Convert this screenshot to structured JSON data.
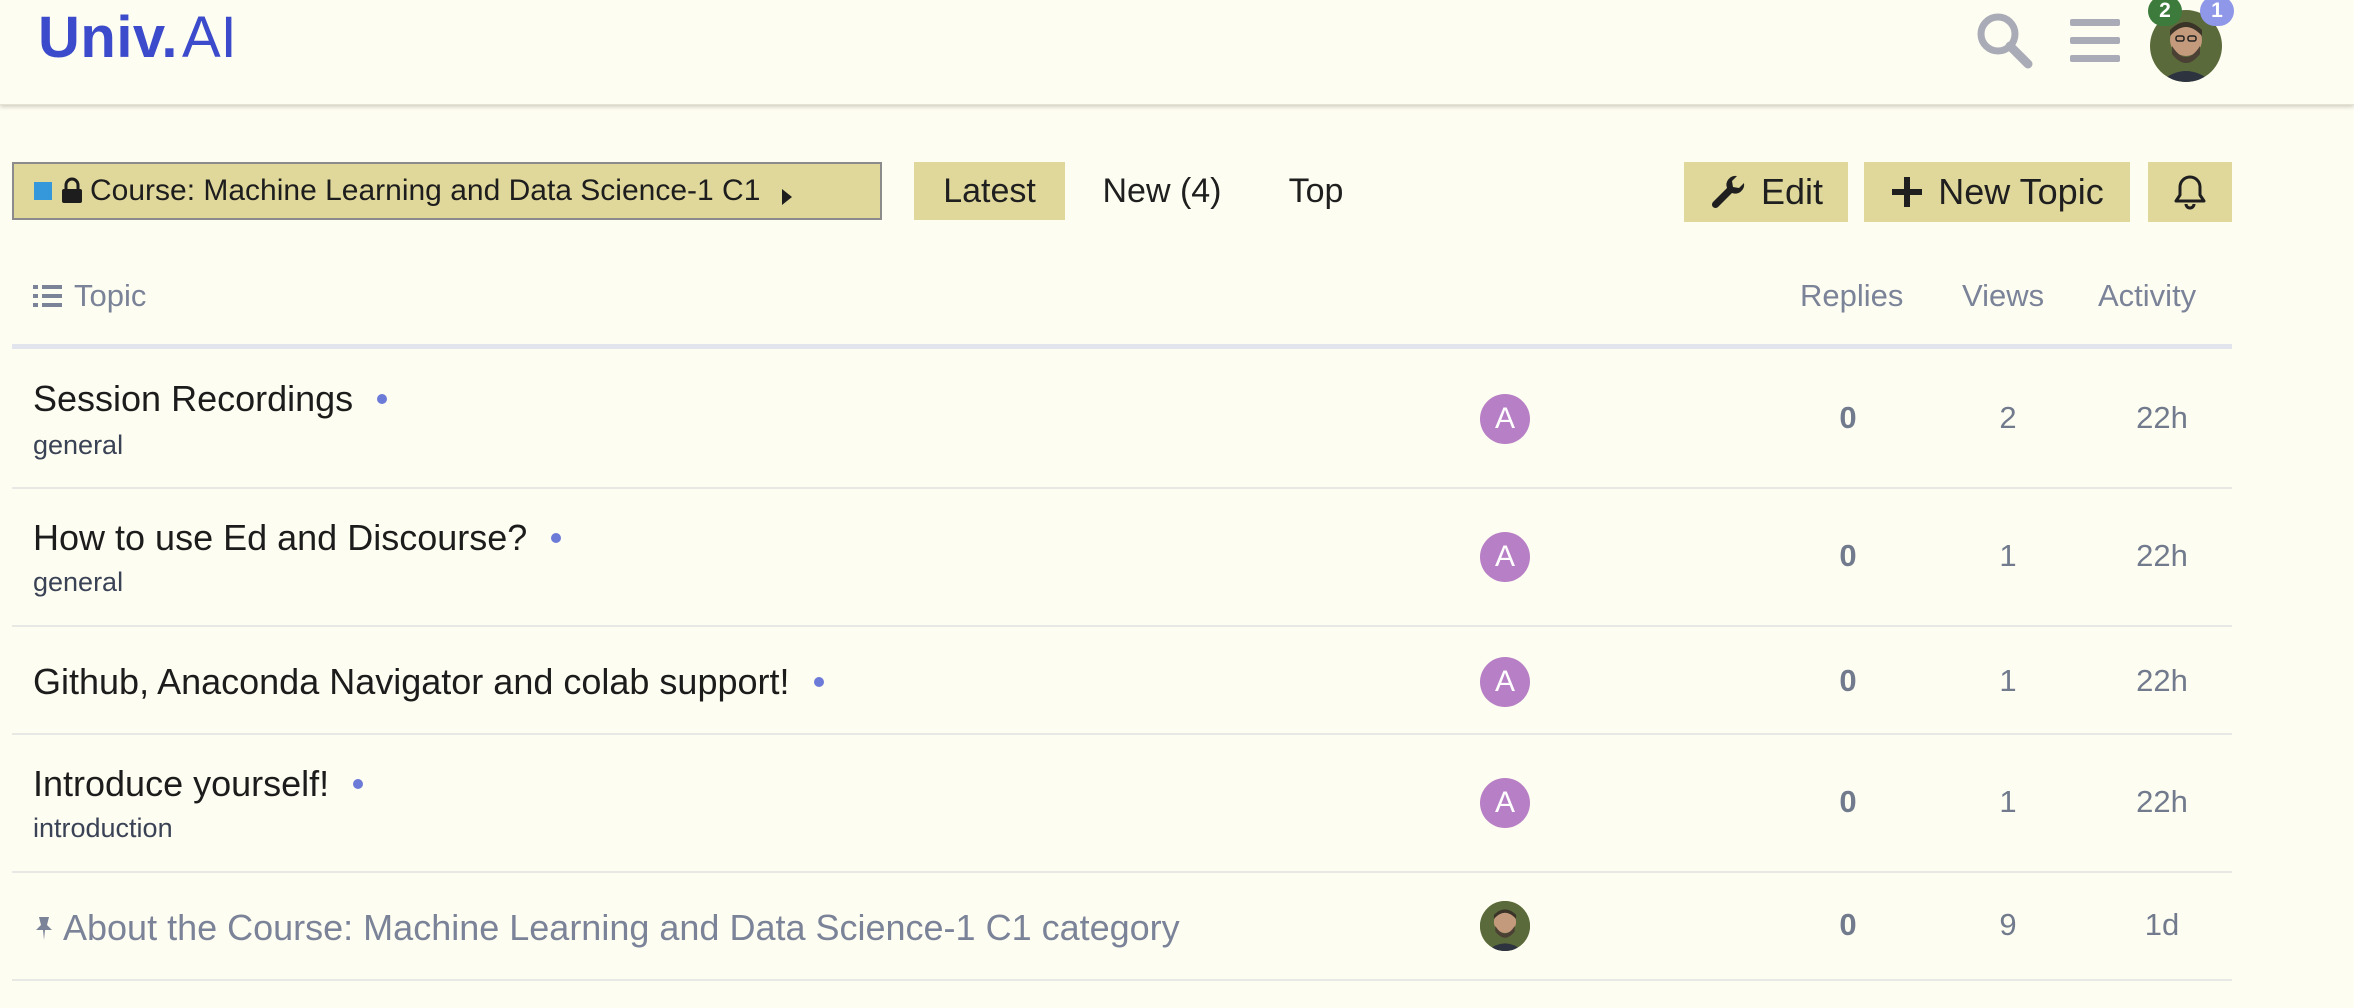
{
  "brand": {
    "name_bold": "Univ.",
    "name_thin": "AI",
    "color": "#3b4bcb"
  },
  "header": {
    "search_icon": "search-icon",
    "menu_icon": "hamburger-menu-icon",
    "notifications_badge": "2",
    "messages_badge": "1"
  },
  "nav": {
    "category_label": "Course: Machine Learning and Data Science-1 C1",
    "category_color": "#3498db",
    "tabs": [
      {
        "label": "Latest",
        "active": true
      },
      {
        "label": "New (4)",
        "active": false
      },
      {
        "label": "Top",
        "active": false
      }
    ],
    "edit_label": "Edit",
    "new_topic_label": "New Topic"
  },
  "table": {
    "headers": {
      "topic": "Topic",
      "replies": "Replies",
      "views": "Views",
      "activity": "Activity"
    },
    "rows": [
      {
        "title": "Session Recordings",
        "tag": "general",
        "poster": "A",
        "replies": "0",
        "views": "2",
        "activity": "22h",
        "unread": true
      },
      {
        "title": "How to use Ed and Discourse?",
        "tag": "general",
        "poster": "A",
        "replies": "0",
        "views": "1",
        "activity": "22h",
        "unread": true
      },
      {
        "title": "Github, Anaconda Navigator and colab support!",
        "tag": "",
        "poster": "A",
        "replies": "0",
        "views": "1",
        "activity": "22h",
        "unread": true
      },
      {
        "title": "Introduce yourself!",
        "tag": "introduction",
        "poster": "A",
        "replies": "0",
        "views": "1",
        "activity": "22h",
        "unread": true
      },
      {
        "title": "About the Course: Machine Learning and Data Science-1 C1 category",
        "tag": "",
        "poster": "photo",
        "replies": "0",
        "views": "9",
        "activity": "1d",
        "pinned": true
      }
    ]
  }
}
